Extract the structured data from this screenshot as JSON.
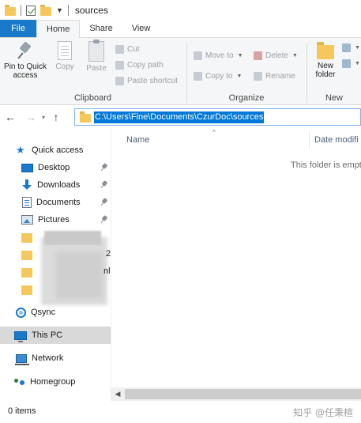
{
  "window": {
    "title": "sources"
  },
  "ribbon_tabs": [
    "File",
    "Home",
    "Share",
    "View"
  ],
  "ribbon": {
    "clipboard": {
      "label": "Clipboard",
      "pin": "Pin to Quick access",
      "copy": "Copy",
      "paste": "Paste",
      "cut": "Cut",
      "copy_path": "Copy path",
      "paste_shortcut": "Paste shortcut"
    },
    "organize": {
      "label": "Organize",
      "move_to": "Move to",
      "copy_to": "Copy to",
      "delete": "Delete",
      "rename": "Rename"
    },
    "new": {
      "label": "New",
      "new_folder": "New folder"
    }
  },
  "address": {
    "path": "C:\\Users\\Fine\\Documents\\CzurDoc\\sources"
  },
  "nav": {
    "quick_access": "Quick access",
    "desktop": "Desktop",
    "downloads": "Downloads",
    "documents": "Documents",
    "pictures": "Pictures",
    "trunc_1": "2",
    "trunc_2": "nl",
    "qsync": "Qsync",
    "this_pc": "This PC",
    "network": "Network",
    "homegroup": "Homegroup"
  },
  "columns": {
    "name": "Name",
    "date_modified": "Date modifi"
  },
  "content": {
    "empty_message": "This folder is empt"
  },
  "status": {
    "items": "0 items"
  },
  "watermark": "知乎 @任秉楦"
}
